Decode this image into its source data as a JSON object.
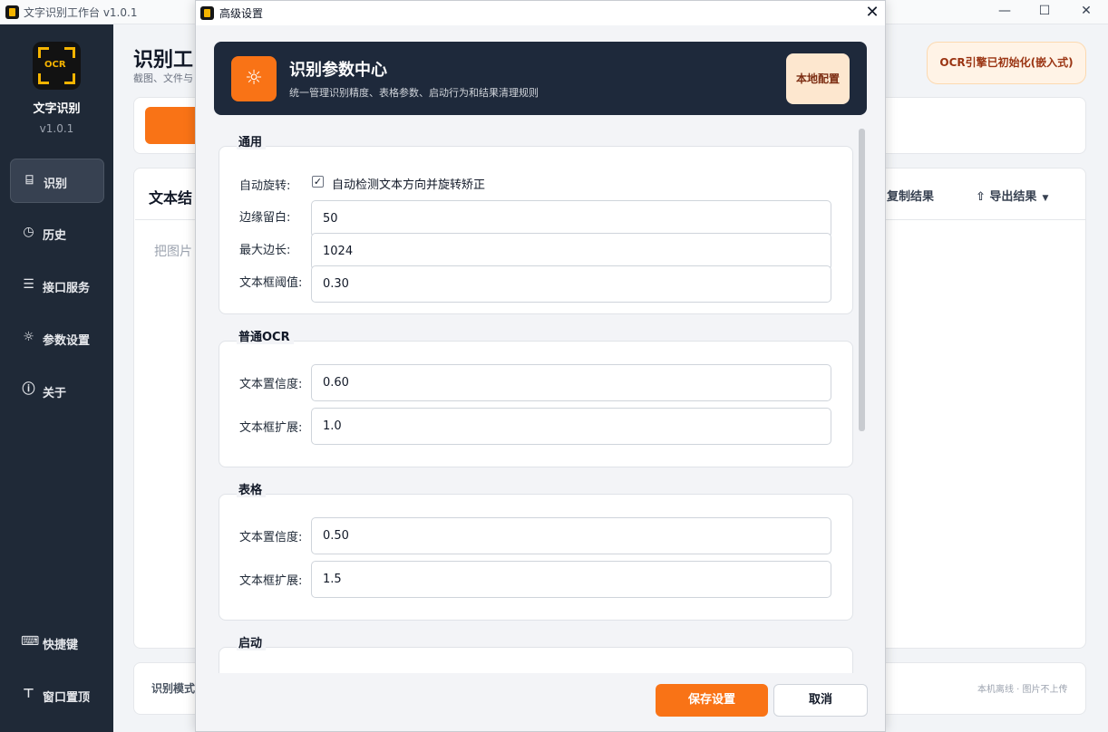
{
  "window": {
    "title": "文字识别工作台 v1.0.1",
    "controls": {
      "minimize": "—",
      "maximize": "☐",
      "close": "✕"
    }
  },
  "sidebar": {
    "app_name": "文字识别",
    "version": "v1.0.1",
    "logo_text": "OCR",
    "items": [
      {
        "label": "识别",
        "icon": "scan-icon",
        "glyph": "⌸",
        "active": true
      },
      {
        "label": "历史",
        "icon": "history-icon",
        "glyph": "◷",
        "active": false
      },
      {
        "label": "接口服务",
        "icon": "server-icon",
        "glyph": "☰",
        "active": false
      },
      {
        "label": "参数设置",
        "icon": "settings-sun-icon",
        "glyph": "☼",
        "active": false
      },
      {
        "label": "关于",
        "icon": "info-icon",
        "glyph": "ⓘ",
        "active": false
      }
    ],
    "bottom_items": [
      {
        "label": "快捷键",
        "icon": "keyboard-icon",
        "glyph": "⌨"
      },
      {
        "label": "窗口置顶",
        "icon": "pin-icon",
        "glyph": "⊤"
      }
    ]
  },
  "main": {
    "title": "识别工",
    "subtitle": "截图、文件与",
    "engine_status": "OCR引擎已初始化(嵌入式)",
    "result_title": "文本结",
    "copy_label": "复制结果",
    "export_label": "导出结果",
    "drop_hint": "把图片",
    "mode_label": "识别模式",
    "offline_hint": "本机离线 · 图片不上传"
  },
  "dialog": {
    "title": "高级设置",
    "close": "✕",
    "hero": {
      "title": "识别参数中心",
      "subtitle": "统一管理识别精度、表格参数、启动行为和结果清理规则",
      "badge": "本地配置",
      "icon": "sun-icon"
    },
    "groups": {
      "general": {
        "title": "通用",
        "auto_rotate_label": "自动旋转:",
        "auto_rotate_checkbox": "自动检测文本方向并旋转矫正",
        "auto_rotate_checked": true,
        "margin_label": "边缘留白:",
        "margin_value": "50",
        "max_side_label": "最大边长:",
        "max_side_value": "1024",
        "box_threshold_label": "文本框阈值:",
        "box_threshold_value": "0.30"
      },
      "normal_ocr": {
        "title": "普通OCR",
        "confidence_label": "文本置信度:",
        "confidence_value": "0.60",
        "expand_label": "文本框扩展:",
        "expand_value": "1.0"
      },
      "table": {
        "title": "表格",
        "confidence_label": "文本置信度:",
        "confidence_value": "0.50",
        "expand_label": "文本框扩展:",
        "expand_value": "1.5"
      },
      "startup": {
        "title": "启动"
      }
    },
    "footer": {
      "save": "保存设置",
      "cancel": "取消"
    }
  },
  "colors": {
    "accent": "#f97316",
    "sidebar_bg": "#1f2937",
    "hero_bg": "#1e293b"
  }
}
